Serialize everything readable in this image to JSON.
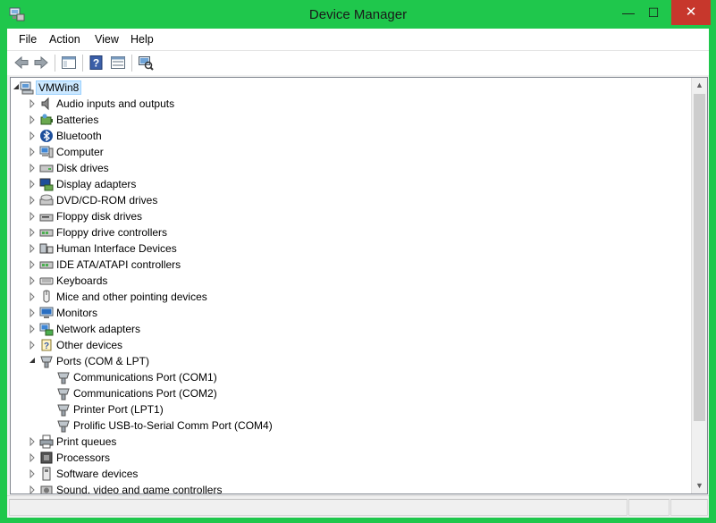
{
  "window": {
    "title": "Device Manager",
    "controls": {
      "minimize": "—",
      "maximize": "☐",
      "close": "✕"
    }
  },
  "menu": [
    "File",
    "Action",
    "View",
    "Help"
  ],
  "toolbar": [
    "back-icon",
    "forward-icon",
    "show-hide-console-tree-icon",
    "help-icon",
    "properties-icon",
    "scan-hardware-changes-icon"
  ],
  "tree": {
    "root": "VMWin8",
    "categories": [
      {
        "label": "Audio inputs and outputs",
        "icon": "speaker-icon",
        "expanded": false
      },
      {
        "label": "Batteries",
        "icon": "battery-icon",
        "expanded": false
      },
      {
        "label": "Bluetooth",
        "icon": "bluetooth-icon",
        "expanded": false
      },
      {
        "label": "Computer",
        "icon": "computer-icon",
        "expanded": false
      },
      {
        "label": "Disk drives",
        "icon": "disk-drive-icon",
        "expanded": false
      },
      {
        "label": "Display adapters",
        "icon": "display-adapter-icon",
        "expanded": false
      },
      {
        "label": "DVD/CD-ROM drives",
        "icon": "dvd-drive-icon",
        "expanded": false
      },
      {
        "label": "Floppy disk drives",
        "icon": "floppy-drive-icon",
        "expanded": false
      },
      {
        "label": "Floppy drive controllers",
        "icon": "controller-icon",
        "expanded": false
      },
      {
        "label": "Human Interface Devices",
        "icon": "hid-icon",
        "expanded": false
      },
      {
        "label": "IDE ATA/ATAPI controllers",
        "icon": "controller-icon",
        "expanded": false
      },
      {
        "label": "Keyboards",
        "icon": "keyboard-icon",
        "expanded": false
      },
      {
        "label": "Mice and other pointing devices",
        "icon": "mouse-icon",
        "expanded": false
      },
      {
        "label": "Monitors",
        "icon": "monitor-icon",
        "expanded": false
      },
      {
        "label": "Network adapters",
        "icon": "network-adapter-icon",
        "expanded": false
      },
      {
        "label": "Other devices",
        "icon": "unknown-device-icon",
        "expanded": false
      },
      {
        "label": "Ports (COM & LPT)",
        "icon": "port-icon",
        "expanded": true,
        "children": [
          {
            "label": "Communications Port (COM1)",
            "icon": "port-icon"
          },
          {
            "label": "Communications Port (COM2)",
            "icon": "port-icon"
          },
          {
            "label": "Printer Port (LPT1)",
            "icon": "port-icon"
          },
          {
            "label": "Prolific USB-to-Serial Comm Port (COM4)",
            "icon": "port-icon"
          }
        ]
      },
      {
        "label": "Print queues",
        "icon": "printer-icon",
        "expanded": false
      },
      {
        "label": "Processors",
        "icon": "processor-icon",
        "expanded": false
      },
      {
        "label": "Software devices",
        "icon": "software-device-icon",
        "expanded": false
      },
      {
        "label": "Sound, video and game controllers",
        "icon": "sound-icon",
        "expanded": false
      }
    ]
  },
  "colors": {
    "titlebar": "#1fc74c",
    "close_button": "#c7372c",
    "selection": "#cce8ff"
  }
}
